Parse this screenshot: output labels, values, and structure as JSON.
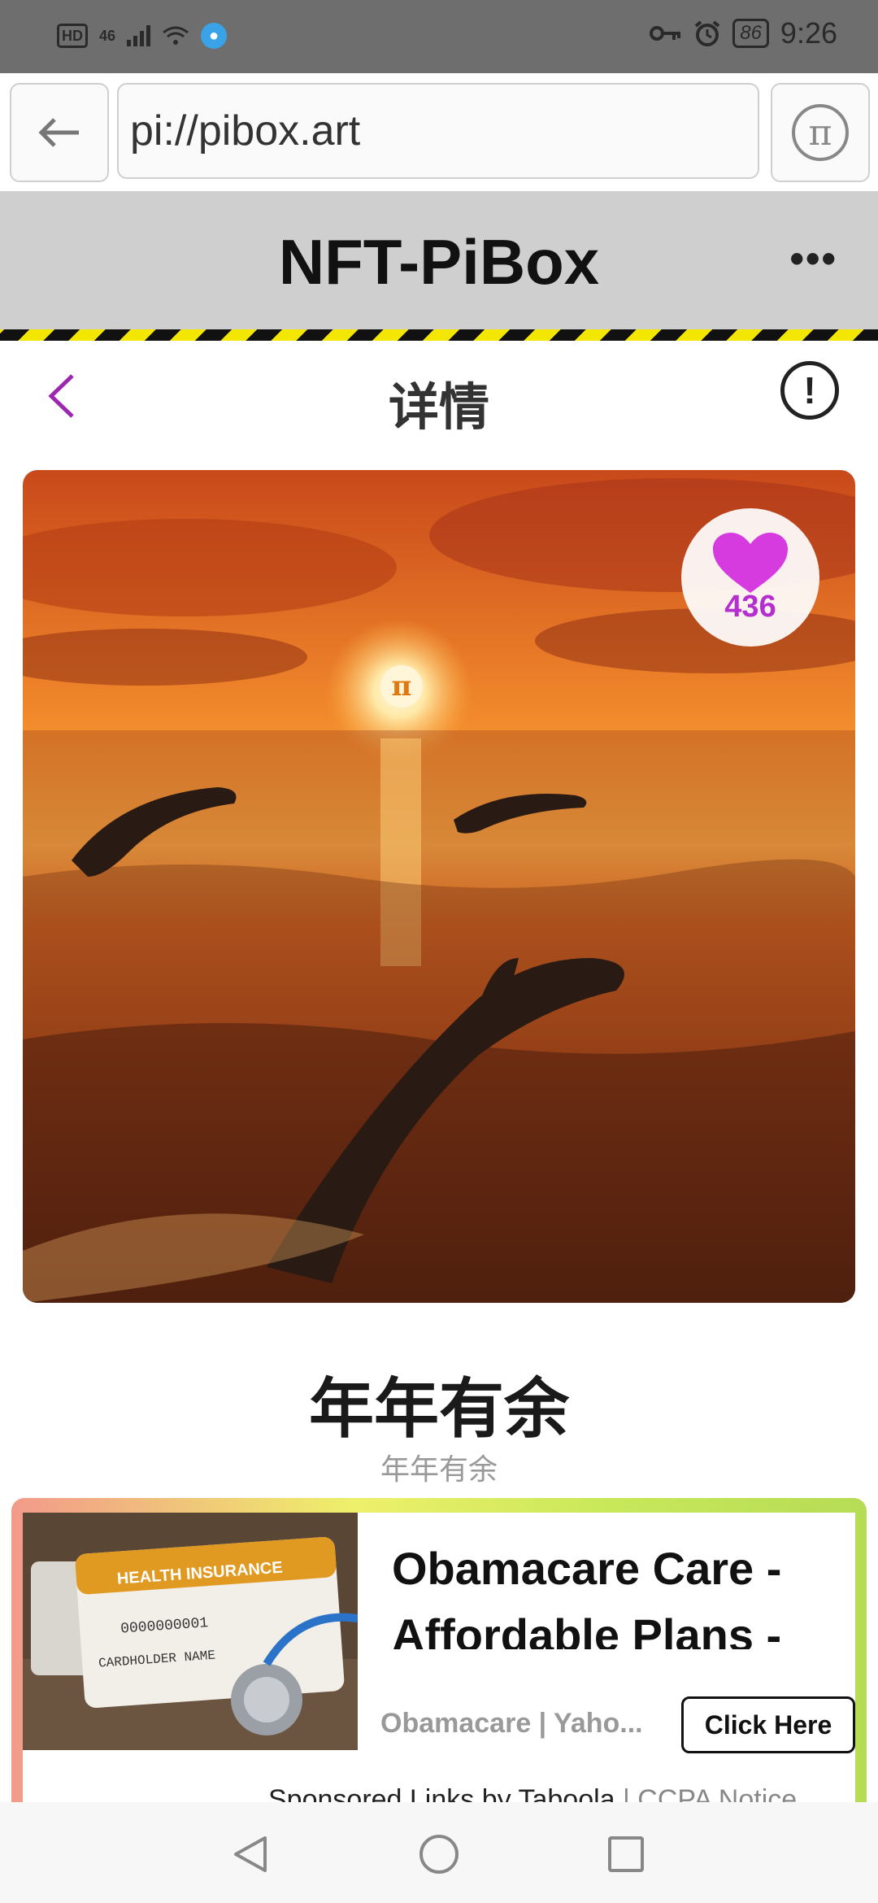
{
  "status_bar": {
    "hd": "HD",
    "network": "46",
    "battery": "86",
    "time": "9:26"
  },
  "browser": {
    "url": "pi://pibox.art"
  },
  "app": {
    "title": "NFT-PiBox"
  },
  "page": {
    "title": "详情"
  },
  "nft": {
    "like_count": "436",
    "title": "年年有余",
    "subtitle": "年年有余"
  },
  "ad": {
    "headline": "Obamacare Care - Affordable Plans - Search Now",
    "source": "Obamacare | Yaho...",
    "cta": "Click Here",
    "card_title": "HEALTH INSURANCE",
    "card_number": "0000000001",
    "card_name": "CARDHOLDER NAME",
    "sponsored": "Sponsored Links by Taboola",
    "ccpa": "CCPA Notice"
  },
  "colors": {
    "accent_purple": "#9c27b0",
    "heart": "#d63be0",
    "hazard_yellow": "#f3e600"
  }
}
